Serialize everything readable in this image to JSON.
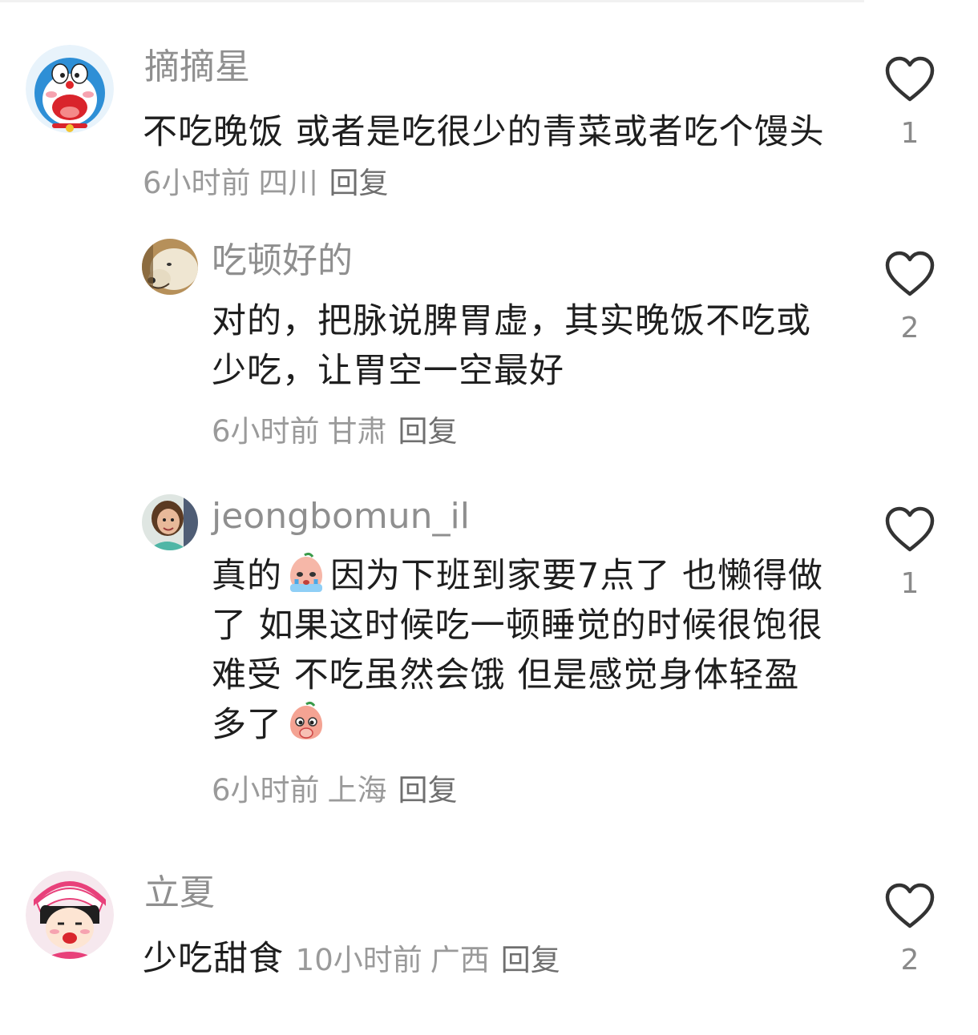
{
  "comments": [
    {
      "username": "摘摘星",
      "text": "不吃晚饭 或者是吃很少的青菜或者吃个馒头",
      "time": "6小时前",
      "region": "四川",
      "reply_label": "回复",
      "likes": "1"
    },
    {
      "username": "吃顿好的",
      "text": "对的，把脉说脾胃虚，其实晚饭不吃或少吃，让胃空一空最好",
      "time": "6小时前",
      "region": "甘肃",
      "reply_label": "回复",
      "likes": "2"
    },
    {
      "username": "jeongbomun_il",
      "text_part1": "真的",
      "text_part2": "因为下班到家要7点了 也懒得做了 如果这时候吃一顿睡觉的时候很饱很难受 不吃虽然会饿 但是感觉身体轻盈多了",
      "time": "6小时前",
      "region": "上海",
      "reply_label": "回复",
      "likes": "1",
      "emoji_1": "crying-peach-emoji",
      "emoji_2": "shy-peach-emoji"
    },
    {
      "username": "立夏",
      "text": "少吃甜食",
      "time": "10小时前",
      "region": "广西",
      "reply_label": "回复",
      "likes": "2"
    }
  ],
  "icons": {
    "like": "heart-outline-icon"
  },
  "colors": {
    "username": "#8f8f8f",
    "body": "#1e1e1e",
    "meta": "#9a9a9a",
    "reply": "#6f6f6f",
    "heart_stroke": "#333333"
  }
}
